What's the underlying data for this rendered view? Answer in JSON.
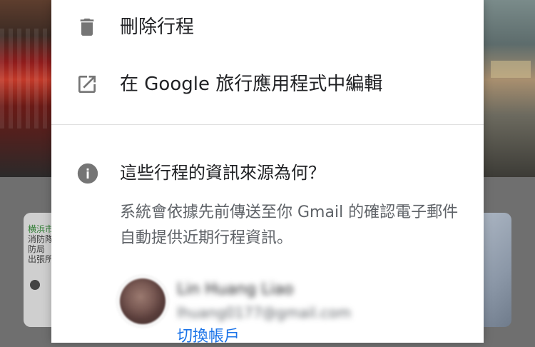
{
  "background": {
    "left_map_text": [
      "横浜市",
      "消防隊",
      "防局",
      "出張所"
    ]
  },
  "dialog": {
    "menu": {
      "delete_label": "刪除行程",
      "edit_label": "在 Google 旅行應用程式中編輯"
    },
    "info": {
      "title": "這些行程的資訊來源為何？",
      "description": "系統會依據先前傳送至你 Gmail 的確認電子郵件自動提供近期行程資訊。"
    },
    "account": {
      "name": "Lin Huang Liao",
      "email": "lhuang0177@gmail.com",
      "switch_label": "切換帳戶"
    },
    "colors": {
      "text_primary": "#202124",
      "text_secondary": "#5f6368",
      "link": "#1a73e8",
      "icon": "#757575",
      "divider": "#e0e0e0"
    }
  }
}
